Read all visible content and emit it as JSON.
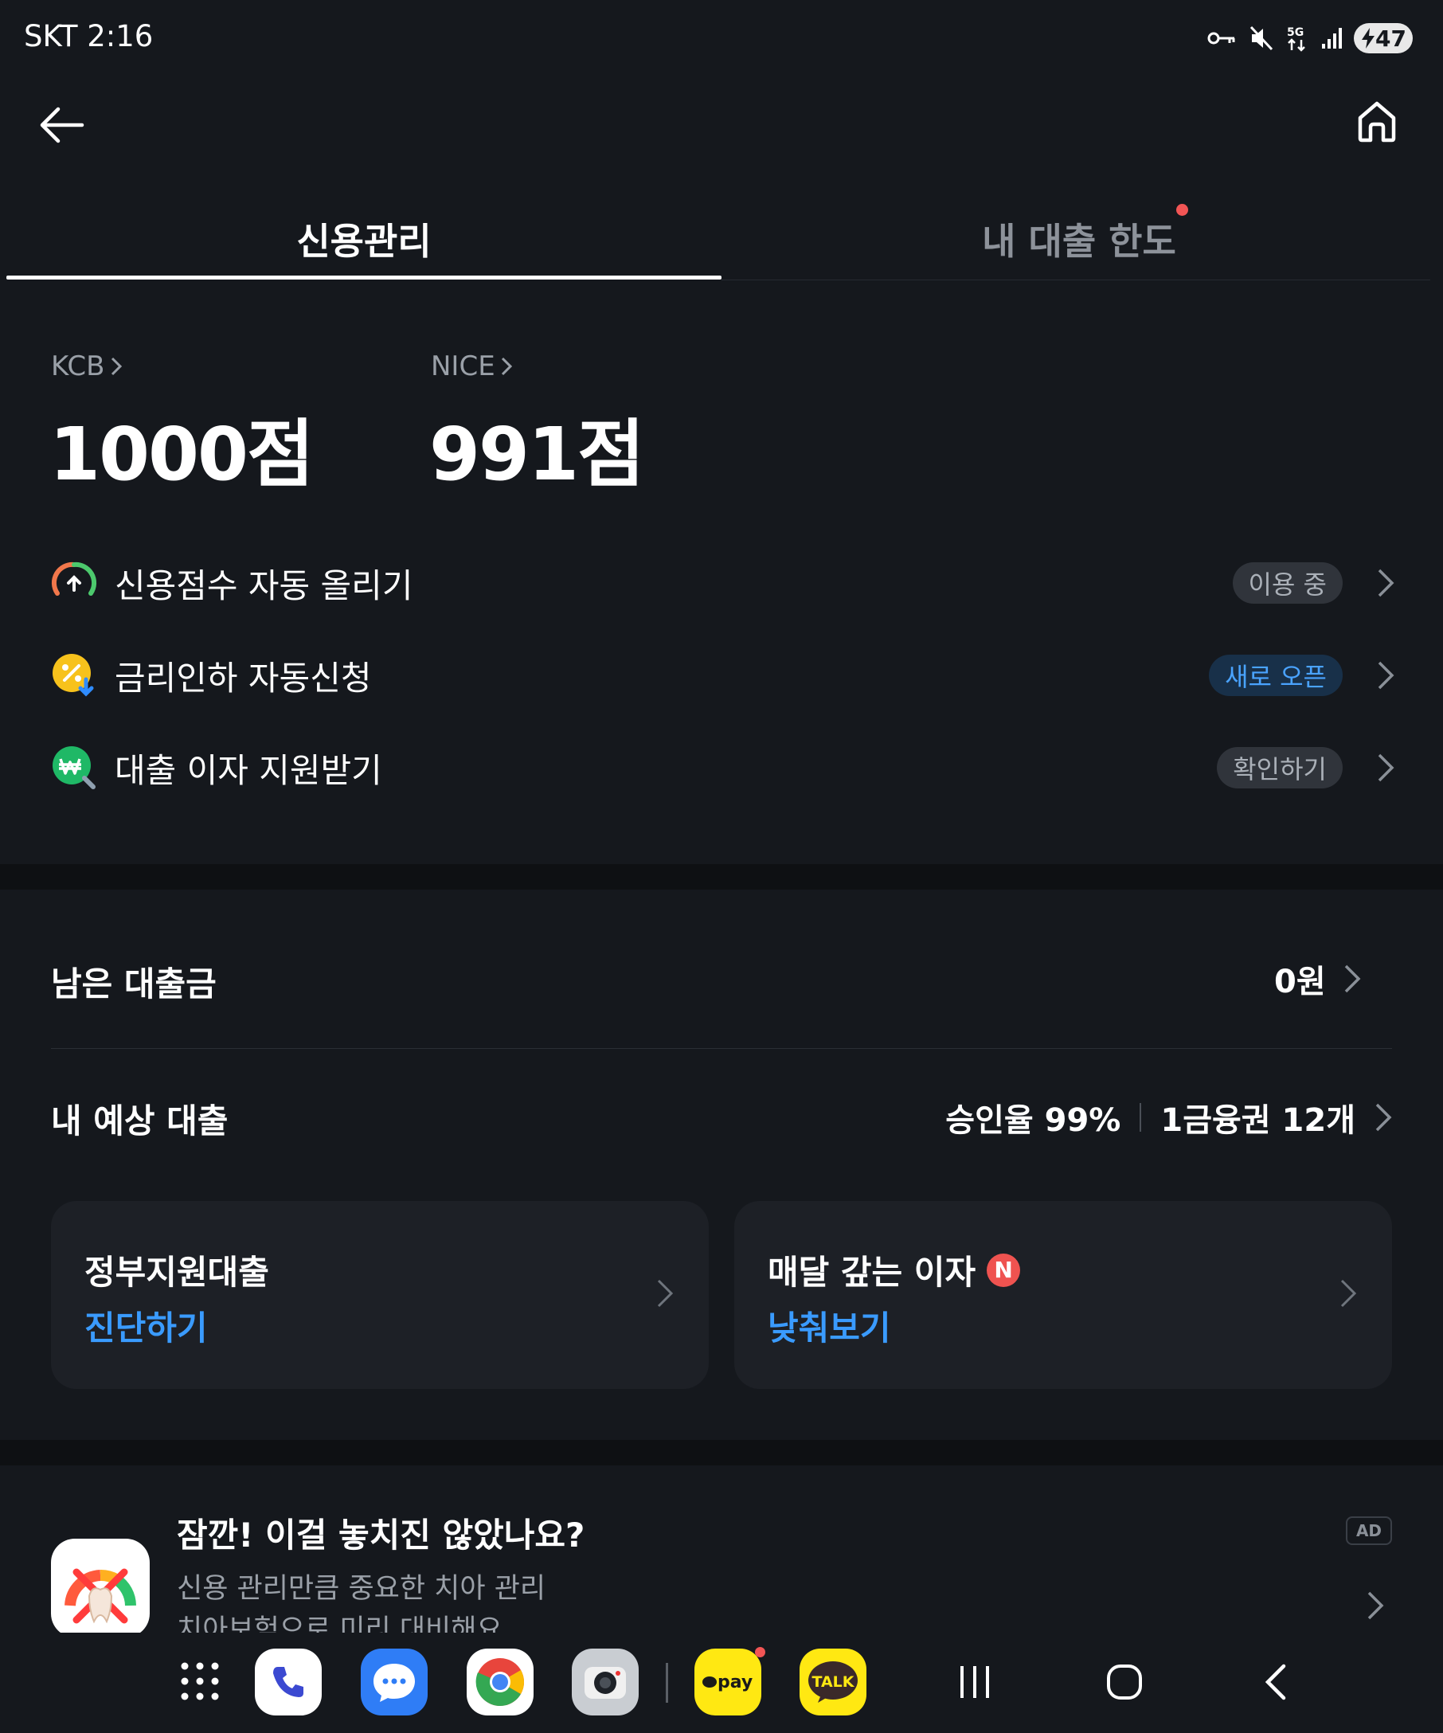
{
  "status_bar": {
    "carrier": "SKT",
    "time": "2:16",
    "network": "5G",
    "battery": "47"
  },
  "tabs": [
    {
      "label": "신용관리",
      "active": true
    },
    {
      "label": "내 대출 한도",
      "active": false,
      "has_dot": true
    }
  ],
  "scores": [
    {
      "label": "KCB",
      "value": "1000점"
    },
    {
      "label": "NICE",
      "value": "991점"
    }
  ],
  "features": [
    {
      "label": "신용점수 자동 올리기",
      "badge": "이용 중",
      "icon": "score-gauge-icon"
    },
    {
      "label": "금리인하 자동신청",
      "badge": "새로 오픈",
      "icon": "rate-down-icon"
    },
    {
      "label": "대출 이자 지원받기",
      "badge": "확인하기",
      "icon": "won-search-icon"
    }
  ],
  "loans": {
    "remaining_label": "남은 대출금",
    "remaining_value": "0원",
    "expected_label": "내 예상 대출",
    "approval": "승인율 99%",
    "tier": "1금융권 12개"
  },
  "cards": [
    {
      "title": "정부지원대출",
      "action": "진단하기",
      "badge": ""
    },
    {
      "title": "매달 갚는 이자",
      "action": "낮춰보기",
      "badge": "N"
    }
  ],
  "ad": {
    "title": "잠깐! 이걸 놓치진 않았나요?",
    "line1": "신용 관리만큼 중요한 치아 관리",
    "line2": "치아보험으로 미리 대비해요",
    "badge": "AD"
  },
  "dock": {
    "apps": [
      "apps-grid-icon",
      "phone-icon",
      "messages-icon",
      "chrome-icon",
      "camera-icon",
      "kakaopay-icon",
      "kakaotalk-icon"
    ],
    "pay_label": "pay",
    "talk_label": "TALK"
  },
  "colors": {
    "background": "#15181d",
    "accent_blue": "#3a9bff",
    "red_dot": "#f25555"
  }
}
